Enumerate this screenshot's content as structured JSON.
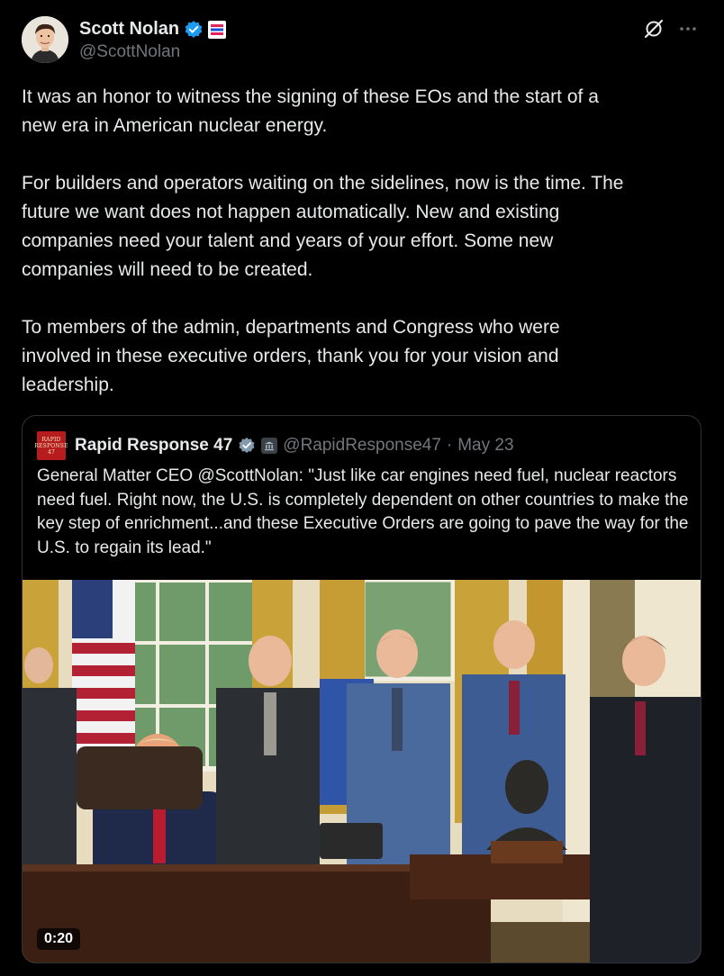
{
  "author": {
    "display_name": "Scott Nolan",
    "handle": "@ScottNolan",
    "verified_icon": "verified-badge-icon",
    "affiliation_icon": "affiliation-badge-icon"
  },
  "post": {
    "paragraphs": [
      "It was an honor to witness the signing of these EOs and the start of a\nnew era in American nuclear energy.",
      "For builders and operators waiting on the sidelines, now is the time. The\nfuture we want does not happen automatically. New and existing\ncompanies need your talent and years of your effort. Some new\ncompanies will need to be created.",
      "To members of the admin, departments and Congress who were\ninvolved in these executive orders, thank you for your vision and\nleadership."
    ]
  },
  "actions": {
    "grok_icon": "grok-icon",
    "more_icon": "more-options-icon"
  },
  "quoted": {
    "avatar_lines": [
      "RAPID",
      "RESPONSE",
      "47"
    ],
    "display_name": "Rapid Response 47",
    "handle": "@RapidResponse47",
    "separator": "·",
    "date": "May 23",
    "text": "General Matter CEO @ScottNolan: \"Just like car engines need fuel, nuclear reactors need fuel. Right now, the U.S. is completely dependent on other countries to make the key step of enrichment...and these Executive Orders are going to pave the way for the U.S. to regain its lead.\"",
    "video_duration": "0:20"
  },
  "colors": {
    "background": "#000000",
    "text": "#e7e9ea",
    "secondary": "#71767b",
    "border": "#2f3336",
    "verified_blue": "#1d9bf0",
    "gov_gray": "#829aab"
  }
}
